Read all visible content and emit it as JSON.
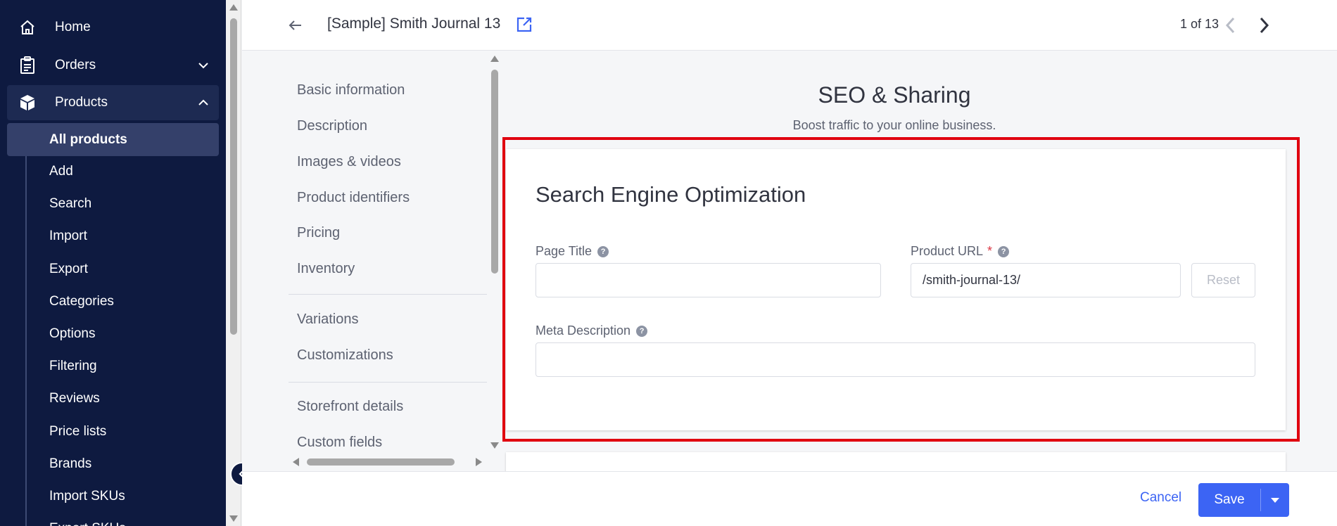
{
  "colors": {
    "nav_bg": "#0e1a40",
    "accent": "#3c64f4",
    "highlight": "#e0000f"
  },
  "sidebar": {
    "top_items": [
      {
        "label": "Home",
        "icon": "home-icon"
      },
      {
        "label": "Orders",
        "icon": "orders-icon"
      },
      {
        "label": "Products",
        "icon": "products-icon"
      }
    ],
    "sub_items": [
      {
        "label": "All products"
      },
      {
        "label": "Add"
      },
      {
        "label": "Search"
      },
      {
        "label": "Import"
      },
      {
        "label": "Export"
      },
      {
        "label": "Categories"
      },
      {
        "label": "Options"
      },
      {
        "label": "Filtering"
      },
      {
        "label": "Reviews"
      },
      {
        "label": "Price lists"
      },
      {
        "label": "Brands"
      },
      {
        "label": "Import SKUs"
      },
      {
        "label": "Export SKUs"
      }
    ]
  },
  "header": {
    "product_title": "[Sample] Smith Journal 13",
    "pager": "1 of 13"
  },
  "section_nav": {
    "items": [
      "Basic information",
      "Description",
      "Images & videos",
      "Product identifiers",
      "Pricing",
      "Inventory",
      "Variations",
      "Customizations",
      "Storefront details",
      "Custom fields"
    ]
  },
  "main": {
    "heading": "SEO & Sharing",
    "subheading": "Boost traffic to your online business.",
    "card": {
      "title": "Search Engine Optimization",
      "page_title_label": "Page Title",
      "page_title_value": "",
      "product_url_label": "Product URL",
      "product_url_required": "*",
      "product_url_value": "/smith-journal-13/",
      "reset_label": "Reset",
      "meta_description_label": "Meta Description",
      "meta_description_value": ""
    }
  },
  "footer": {
    "cancel_label": "Cancel",
    "save_label": "Save"
  }
}
